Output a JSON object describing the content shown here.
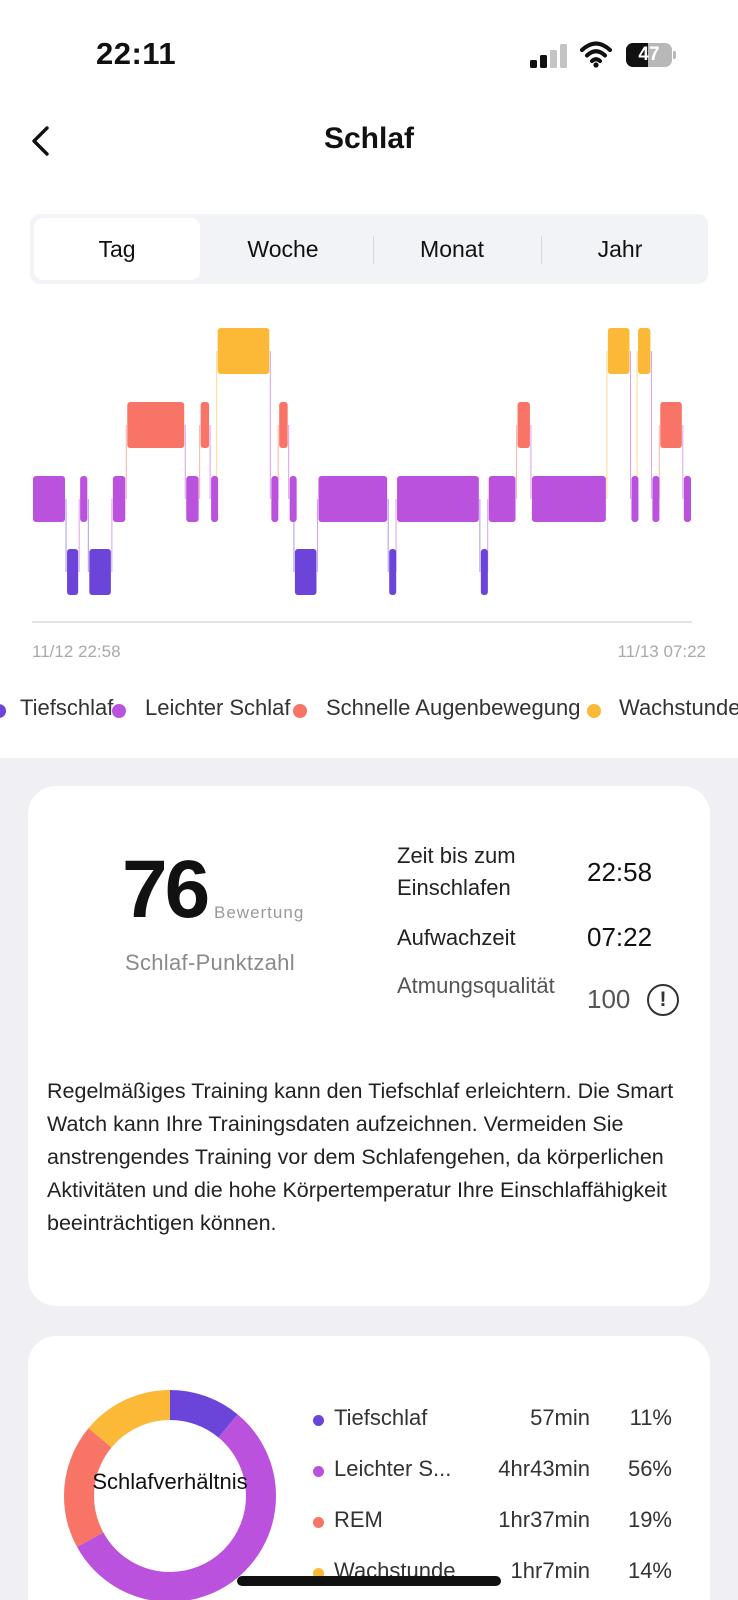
{
  "status_bar": {
    "time": "22:11",
    "battery": "47",
    "battery_level": 0.47
  },
  "header": {
    "title": "Schlaf"
  },
  "tabs": [
    {
      "label": "Tag",
      "active": true
    },
    {
      "label": "Woche",
      "active": false
    },
    {
      "label": "Monat",
      "active": false
    },
    {
      "label": "Jahr",
      "active": false
    }
  ],
  "colors": {
    "deep": "#6b44d9",
    "light": "#bb52dd",
    "rem": "#f87466",
    "awake": "#fbb937"
  },
  "chart_data": {
    "type": "timeline",
    "x_start_label": "11/12 22:58",
    "x_end_label": "11/13 07:22",
    "x_range_minutes": [
      0,
      504
    ],
    "levels": [
      "awake",
      "rem",
      "light",
      "deep"
    ],
    "segments": [
      {
        "stage": "light",
        "start": 0,
        "end": 26
      },
      {
        "stage": "deep",
        "start": 26,
        "end": 36
      },
      {
        "stage": "light",
        "start": 36,
        "end": 43
      },
      {
        "stage": "deep",
        "start": 43,
        "end": 61
      },
      {
        "stage": "light",
        "start": 61,
        "end": 72
      },
      {
        "stage": "rem",
        "start": 72,
        "end": 117
      },
      {
        "stage": "light",
        "start": 117,
        "end": 128
      },
      {
        "stage": "rem",
        "start": 128,
        "end": 136
      },
      {
        "stage": "light",
        "start": 136,
        "end": 141
      },
      {
        "stage": "awake",
        "start": 141,
        "end": 182
      },
      {
        "stage": "light",
        "start": 182,
        "end": 188
      },
      {
        "stage": "rem",
        "start": 188,
        "end": 196
      },
      {
        "stage": "light",
        "start": 196,
        "end": 200
      },
      {
        "stage": "deep",
        "start": 200,
        "end": 218
      },
      {
        "stage": "light",
        "start": 218,
        "end": 272
      },
      {
        "stage": "deep",
        "start": 272,
        "end": 278
      },
      {
        "stage": "light",
        "start": 278,
        "end": 342
      },
      {
        "stage": "deep",
        "start": 342,
        "end": 348
      },
      {
        "stage": "light",
        "start": 348,
        "end": 370
      },
      {
        "stage": "rem",
        "start": 370,
        "end": 381
      },
      {
        "stage": "light",
        "start": 381,
        "end": 439
      },
      {
        "stage": "awake",
        "start": 439,
        "end": 457
      },
      {
        "stage": "light",
        "start": 457,
        "end": 462
      },
      {
        "stage": "awake",
        "start": 462,
        "end": 473
      },
      {
        "stage": "light",
        "start": 473,
        "end": 479
      },
      {
        "stage": "rem",
        "start": 479,
        "end": 497
      },
      {
        "stage": "light",
        "start": 497,
        "end": 504
      }
    ]
  },
  "legend": [
    {
      "label": "Tiefschlaf",
      "color": "#6b44d9"
    },
    {
      "label": "Leichter Schlaf",
      "color": "#bb52dd"
    },
    {
      "label": "Schnelle Augenbewegung",
      "color": "#f87466"
    },
    {
      "label": "Wachstunde",
      "color": "#fbb937"
    }
  ],
  "summary": {
    "score": "76",
    "score_unit": "Bewertung",
    "score_label": "Schlaf-Punktzahl",
    "fall_asleep_label": "Zeit bis zum Einschlafen",
    "fall_asleep_value": "22:58",
    "wake_label": "Aufwachzeit",
    "wake_value": "07:22",
    "breathing_label": "Atmungsqualität",
    "breathing_value": "100",
    "info_icon": "info-icon"
  },
  "advice": "Regelmäßiges Training kann den Tiefschlaf erleichtern. Die Smart Watch kann Ihre Trainingsdaten aufzeichnen. Vermeiden Sie anstrengendes Training vor dem Schlafengehen, da körperlichen Aktivitäten und die hohe Körpertemperatur Ihre Einschlaffähigkeit beeinträchtigen können.",
  "breakdown": {
    "title": "Schlafverhältnis",
    "items": [
      {
        "name": "Tiefschlaf",
        "duration": "57min",
        "percent": "11%",
        "value": 11,
        "color": "#6b44d9"
      },
      {
        "name": "Leichter S...",
        "duration": "4hr43min",
        "percent": "56%",
        "value": 56,
        "color": "#bb52dd"
      },
      {
        "name": "REM",
        "duration": "1hr37min",
        "percent": "19%",
        "value": 19,
        "color": "#f87466"
      },
      {
        "name": "Wachstunde",
        "duration": "1hr7min",
        "percent": "14%",
        "value": 14,
        "color": "#fbb937"
      }
    ]
  }
}
